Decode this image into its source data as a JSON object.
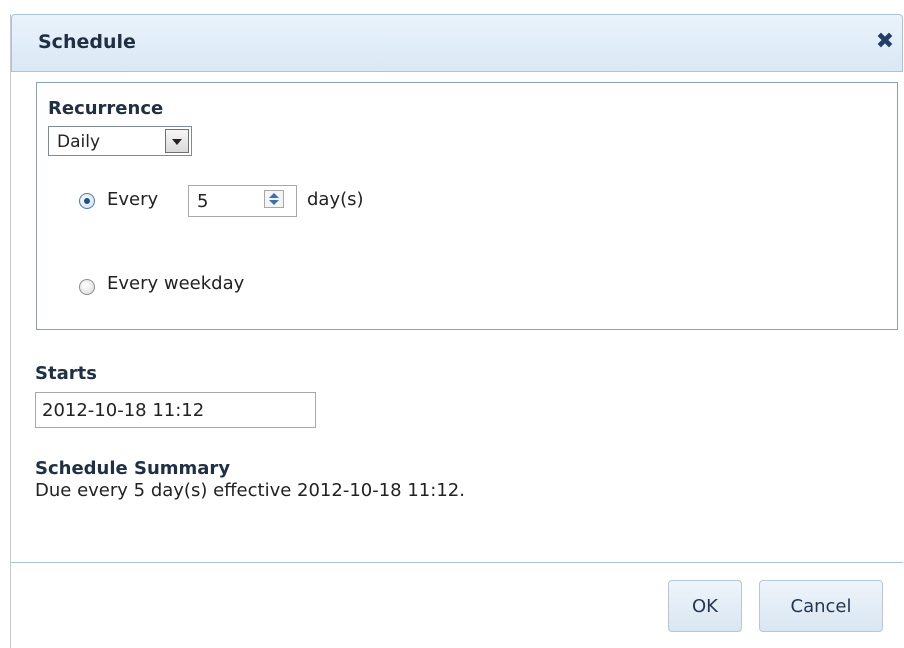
{
  "dialog": {
    "title": "Schedule",
    "close_glyph": "✖"
  },
  "recurrence": {
    "label": "Recurrence",
    "frequency": "Daily",
    "every_option": {
      "prefix": "Every",
      "value": "5",
      "suffix": "day(s)",
      "selected": true
    },
    "weekday_option": {
      "label": "Every weekday",
      "selected": false
    }
  },
  "starts": {
    "label": "Starts",
    "value": "2012-10-18 11:12"
  },
  "summary": {
    "label": "Schedule Summary",
    "text": "Due every 5 day(s) effective 2012-10-18 11:12."
  },
  "buttons": {
    "ok": "OK",
    "cancel": "Cancel"
  }
}
